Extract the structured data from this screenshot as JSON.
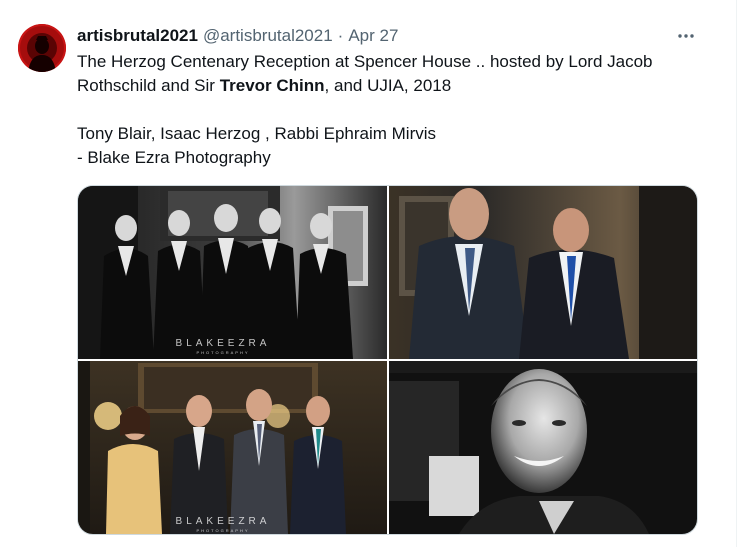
{
  "tweet": {
    "display_name": "artisbrutal2021",
    "handle": "@artisbrutal2021",
    "separator": "·",
    "date": "Apr 27",
    "more_icon": "more-horizontal-icon",
    "text": {
      "line1_part1": "The Herzog Centenary Reception at Spencer House .. hosted by Lord Jacob Rothschild and Sir ",
      "line1_bold": "Trevor  Chinn",
      "line1_part2": ", and UJIA, 2018",
      "line2": "Tony Blair, Isaac Herzog , Rabbi Ephraim Mirvis",
      "line3": "- Blake Ezra Photography"
    }
  },
  "media": {
    "photos": [
      {
        "subject": "bw-group-five-men",
        "watermark": "BLAKEEZRA",
        "watermark_sub": "PHOTOGRAPHY"
      },
      {
        "subject": "color-two-men-talking"
      },
      {
        "subject": "color-group-four-people",
        "watermark": "BLAKEEZRA",
        "watermark_sub": "PHOTOGRAPHY"
      },
      {
        "subject": "bw-portrait-smiling-man"
      }
    ]
  },
  "colors": {
    "text_primary": "#0f1419",
    "text_secondary": "#536471",
    "border": "#cfd9de",
    "avatar_red": "#c11010"
  }
}
